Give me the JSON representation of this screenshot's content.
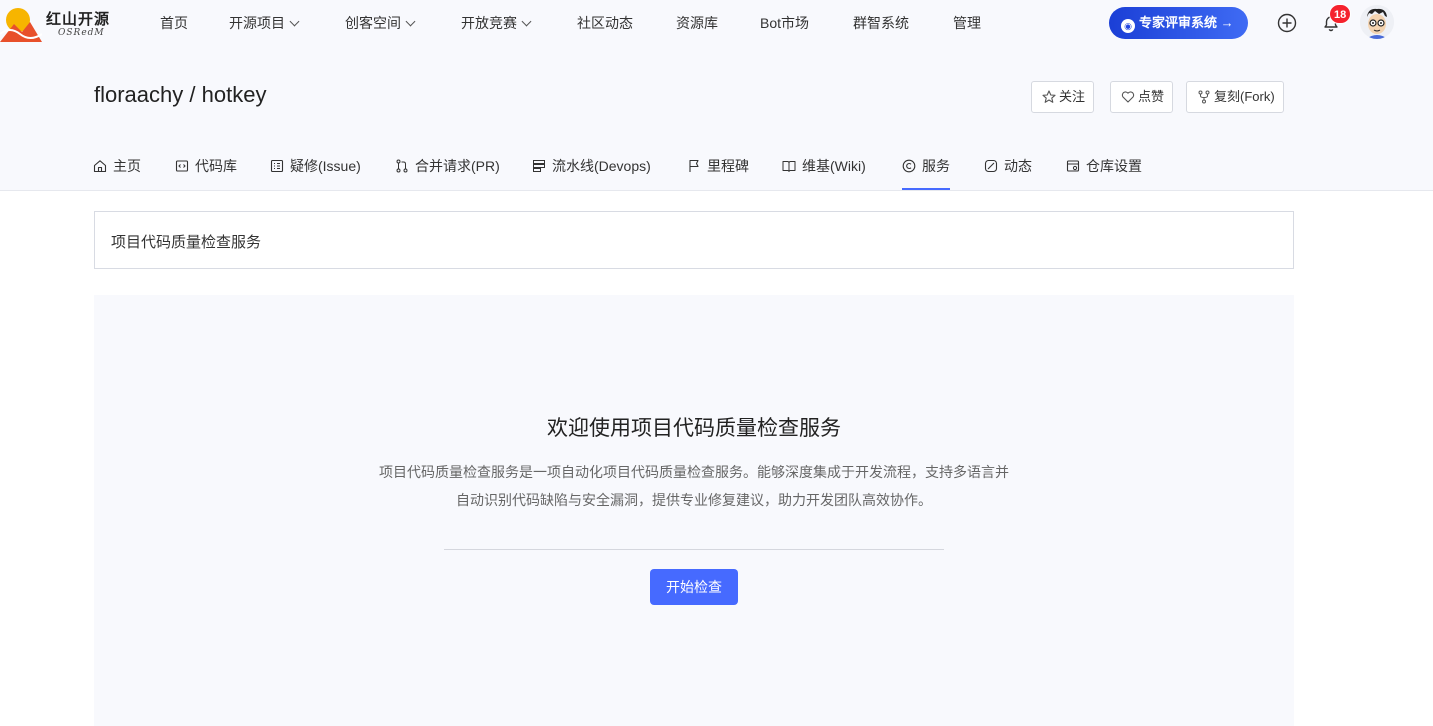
{
  "brand": {
    "name": "红山开源",
    "sub": "OSRedM"
  },
  "nav": {
    "home": "首页",
    "open_source_projects": "开源项目",
    "maker_space": "创客空间",
    "open_competition": "开放竞赛",
    "community_news": "社区动态",
    "resources": "资源库",
    "bot_market": "Bot市场",
    "swarm_system": "群智系统",
    "admin": "管理"
  },
  "expert_button": "专家评审系统",
  "notifications": {
    "count": "18"
  },
  "repo": {
    "owner": "floraachy",
    "separator": " / ",
    "name": "hotkey",
    "watch_label": "关注",
    "like_label": "点赞",
    "fork_label": "复刻(Fork)"
  },
  "tabs": {
    "home": "主页",
    "code": "代码库",
    "issues": "疑修(Issue)",
    "pr": "合并请求(PR)",
    "devops": "流水线(Devops)",
    "milestones": "里程碑",
    "wiki": "维基(Wiki)",
    "services": "服务",
    "activity": "动态",
    "settings": "仓库设置"
  },
  "service": {
    "bar_title": "项目代码质量检查服务",
    "welcome_title": "欢迎使用项目代码质量检查服务",
    "desc_line1": "项目代码质量检查服务是一项自动化项目代码质量检查服务。能够深度集成于开发流程，支持多语言并",
    "desc_line2": "自动识别代码缺陷与安全漏洞，提供专业修复建议，助力开发团队高效协作。",
    "start_button": "开始检查"
  },
  "colors": {
    "accent": "#466aff",
    "badge": "#f5222d",
    "header_bg": "#f8f9fd"
  },
  "icons": [
    "plus-circle-icon",
    "bell-icon",
    "star-icon",
    "heart-icon",
    "fork-icon",
    "home-icon",
    "code-icon",
    "issue-icon",
    "pull-request-icon",
    "pipeline-icon",
    "flag-icon",
    "book-icon",
    "service-icon",
    "activity-icon",
    "settings-icon"
  ]
}
